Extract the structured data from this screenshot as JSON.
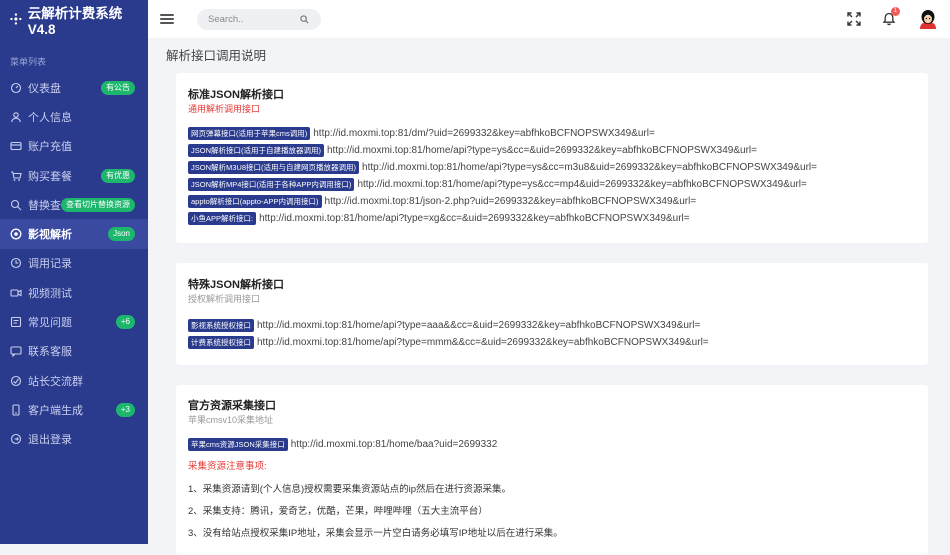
{
  "brand": {
    "title": "云解析计费系统V4.8"
  },
  "sidebar": {
    "caption": "菜单列表",
    "items": [
      {
        "label": "仪表盘",
        "badge": "有公告",
        "icon": "dashboard-icon"
      },
      {
        "label": "个人信息",
        "badge": "",
        "icon": "user-icon"
      },
      {
        "label": "账户充值",
        "badge": "",
        "icon": "card-icon"
      },
      {
        "label": "购买套餐",
        "badge": "有优惠",
        "icon": "cart-icon"
      },
      {
        "label": "替换查询",
        "badge": "查看切片替换资源",
        "icon": "search-icon"
      },
      {
        "label": "影视解析",
        "badge": "Json",
        "icon": "film-icon"
      },
      {
        "label": "调用记录",
        "badge": "",
        "icon": "record-icon"
      },
      {
        "label": "视频测试",
        "badge": "",
        "icon": "video-icon"
      },
      {
        "label": "常见问题",
        "badge": "+6",
        "icon": "question-icon"
      },
      {
        "label": "联系客服",
        "badge": "",
        "icon": "chat-icon"
      },
      {
        "label": "站长交流群",
        "badge": "",
        "icon": "group-icon"
      },
      {
        "label": "客户端生成",
        "badge": "+3",
        "icon": "phone-icon"
      },
      {
        "label": "退出登录",
        "badge": "",
        "icon": "logout-icon"
      }
    ],
    "active_index": 5
  },
  "topbar": {
    "search_placeholder": "Search..",
    "notification_count": "1"
  },
  "page": {
    "title": "解析接口调用说明"
  },
  "cards": {
    "standard": {
      "title": "标准JSON解析接口",
      "subtitle": "通用解析调用接口",
      "rows": [
        {
          "tag": "网页弹幕接口(适用于苹果cms调用)",
          "url": "http://id.moxmi.top:81/dm/?uid=2699332&key=abfhkoBCFNOPSWX349&url="
        },
        {
          "tag": "JSON解析接口(适用于自建播放器调用)",
          "url": "http://id.moxmi.top:81/home/api?type=ys&cc=&uid=2699332&key=abfhkoBCFNOPSWX349&url="
        },
        {
          "tag": "JSON解析M3U8接口(适用与自建网页播放器调用)",
          "url": "http://id.moxmi.top:81/home/api?type=ys&cc=m3u8&uid=2699332&key=abfhkoBCFNOPSWX349&url="
        },
        {
          "tag": "JSON解析MP4接口(适用于各种APP内调用接口)",
          "url": "http://id.moxmi.top:81/home/api?type=ys&cc=mp4&uid=2699332&key=abfhkoBCFNOPSWX349&url="
        },
        {
          "tag": "appto解析接口(appto-APP内调用接口)",
          "url": "http://id.moxmi.top:81/json-2.php?uid=2699332&key=abfhkoBCFNOPSWX349&url="
        },
        {
          "tag": "小鱼APP解析接口:",
          "url": "http://id.moxmi.top:81/home/api?type=xg&cc=&uid=2699332&key=abfhkoBCFNOPSWX349&url="
        }
      ]
    },
    "special": {
      "title": "特殊JSON解析接口",
      "subtitle": "授权解析调用接口",
      "rows": [
        {
          "tag": "影视系统授权接口",
          "url": "http://id.moxmi.top:81/home/api?type=aaa&&cc=&uid=2699332&key=abfhkoBCFNOPSWX349&url="
        },
        {
          "tag": "计费系统授权接口",
          "url": "http://id.moxmi.top:81/home/api?type=mmm&&cc=&uid=2699332&key=abfhkoBCFNOPSWX349&url="
        }
      ]
    },
    "official": {
      "title": "官方资源采集接口",
      "subtitle": "苹果cmsv10采集地址",
      "rows": [
        {
          "tag": "苹果cms资源JSON采集接口",
          "url": "http://id.moxmi.top:81/home/baa?uid=2699332"
        }
      ],
      "notes_title": "采集资源注意事项:",
      "notes": [
        "1、采集资源请到(个人信息)授权需要采集资源站点的ip然后在进行资源采集。",
        "2、采集支持：腾讯，爱奇艺，优酷，芒果，哔哩哔哩（五大主流平台）",
        "3、没有给站点授权采集IP地址，采集会显示一片空白请务必填写IP地址以后在进行采集。"
      ]
    }
  }
}
